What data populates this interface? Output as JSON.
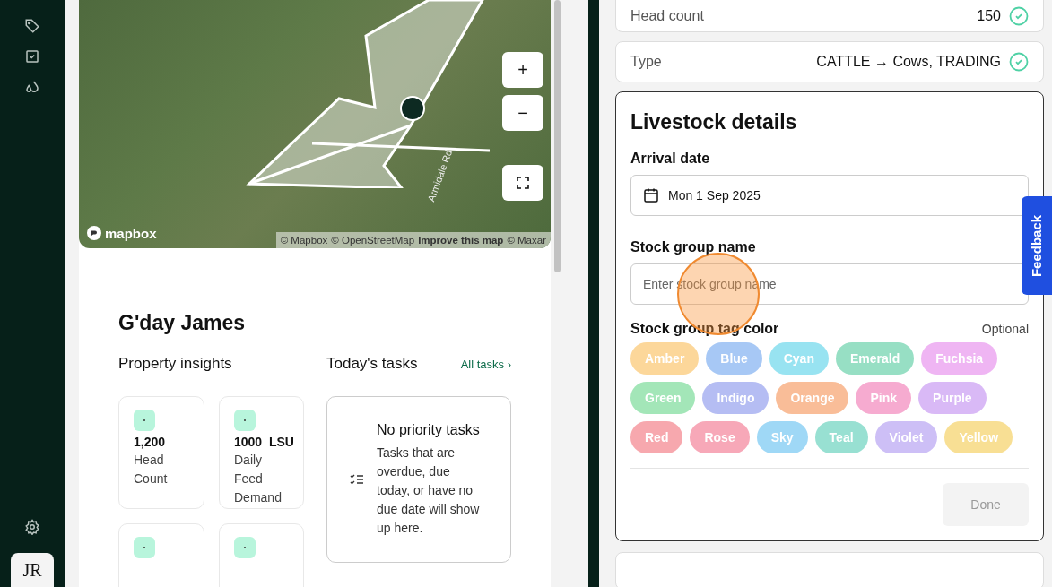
{
  "sidebar": {
    "avatar": "JR"
  },
  "map": {
    "logo": "mapbox",
    "road_label": "Armidale Rd",
    "attribution": [
      {
        "text": "© Mapbox",
        "bold": false
      },
      {
        "text": "© OpenStreetMap",
        "bold": false
      },
      {
        "text": "Improve this map",
        "bold": true
      },
      {
        "text": "© Maxar",
        "bold": false
      }
    ],
    "controls": [
      {
        "kind": "zoom-in",
        "label": "+"
      },
      {
        "kind": "zoom-out",
        "label": "−"
      },
      {
        "kind": "fullscreen"
      }
    ]
  },
  "greeting": "G'day James",
  "insights": {
    "title": "Property insights",
    "cards": [
      {
        "value": "1,200",
        "label": "Head Count"
      },
      {
        "value": "1000",
        "unit": "LSU",
        "label": "Daily Feed Demand"
      }
    ]
  },
  "tasks": {
    "title": "Today's tasks",
    "link": "All tasks",
    "link_chevron": "›",
    "empty_title": "No priority tasks",
    "empty_text": "Tasks that are overdue, due today, or have no due date will show up here."
  },
  "summary_rows": [
    {
      "label": "Head count",
      "value": "150",
      "confirmed": true
    },
    {
      "label": "Type",
      "value": "CATTLE → Cows, TRADING",
      "confirmed": true
    }
  ],
  "livestock_details": {
    "title": "Livestock details",
    "arrival_label": "Arrival date",
    "arrival_value": "Mon 1 Sep 2025",
    "name_label": "Stock group name",
    "name_placeholder": "Enter stock group name",
    "tag_label": "Stock group tag color",
    "tag_hint": "Optional",
    "tags": [
      {
        "label": "Amber",
        "color": "#fcd79a"
      },
      {
        "label": "Blue",
        "color": "#a7c8f5"
      },
      {
        "label": "Cyan",
        "color": "#98e3f1"
      },
      {
        "label": "Emerald",
        "color": "#97dfc4"
      },
      {
        "label": "Fuchsia",
        "color": "#efb5f3"
      },
      {
        "label": "Green",
        "color": "#a3e6b8"
      },
      {
        "label": "Indigo",
        "color": "#b5bdf3"
      },
      {
        "label": "Orange",
        "color": "#f9bd98"
      },
      {
        "label": "Pink",
        "color": "#f6abd0"
      },
      {
        "label": "Purple",
        "color": "#d9b9f6"
      },
      {
        "label": "Red",
        "color": "#f7a8ae"
      },
      {
        "label": "Rose",
        "color": "#f7a8b8"
      },
      {
        "label": "Sky",
        "color": "#9fd8f6"
      },
      {
        "label": "Teal",
        "color": "#98e0d2"
      },
      {
        "label": "Violet",
        "color": "#cdbff6"
      },
      {
        "label": "Yellow",
        "color": "#f8df94"
      }
    ],
    "done": {
      "label": "Done",
      "disabled": true
    }
  },
  "feedback": "Feedback",
  "click_indicator": true
}
